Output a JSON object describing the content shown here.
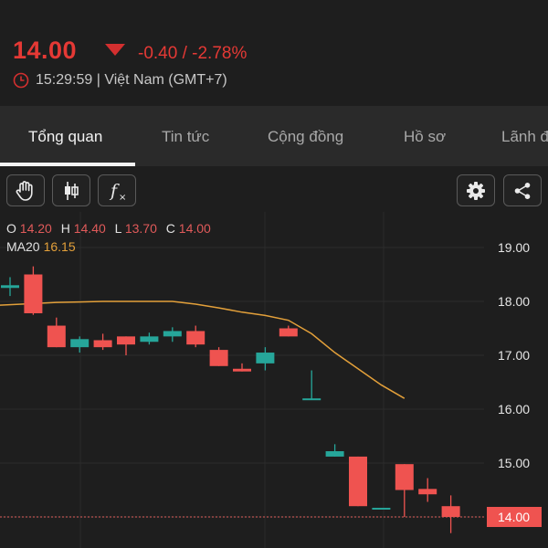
{
  "quote": {
    "price": "14.00",
    "change": "-0.40 / -2.78%",
    "time": "15:29:59 | Việt Nam (GMT+7)",
    "direction_icon": "triangle-down-icon",
    "color_down": "#e53935"
  },
  "tabs": [
    "Tổng quan",
    "Tin tức",
    "Cộng đồng",
    "Hồ sơ",
    "Lãnh đ"
  ],
  "active_tab": "Tổng quan",
  "toolbar": {
    "left_icons": [
      "hand-icon",
      "candlestick-icon",
      "fx-indicator-icon"
    ],
    "right_icons": [
      "gear-icon",
      "share-icon"
    ]
  },
  "ohlc": {
    "o_label": "O",
    "o": "14.20",
    "h_label": "H",
    "h": "14.40",
    "l_label": "L",
    "l": "13.70",
    "c_label": "C",
    "c": "14.00"
  },
  "ma": {
    "label": "MA20",
    "value": "16.15",
    "color": "#e3a03a"
  },
  "chart_data": {
    "type": "candlestick",
    "y_ticks": [
      "19.00",
      "18.00",
      "17.00",
      "16.00",
      "15.00",
      "14.00"
    ],
    "last_price_label": "14.00",
    "colors": {
      "up": "#26a69a",
      "down": "#ef5350",
      "ma": "#e3a03a"
    },
    "candles": [
      {
        "o": 18.25,
        "h": 18.45,
        "l": 18.1,
        "c": 18.3
      },
      {
        "o": 18.5,
        "h": 18.65,
        "l": 17.75,
        "c": 17.78
      },
      {
        "o": 17.55,
        "h": 17.7,
        "l": 17.15,
        "c": 17.15
      },
      {
        "o": 17.15,
        "h": 17.35,
        "l": 17.05,
        "c": 17.3
      },
      {
        "o": 17.28,
        "h": 17.4,
        "l": 17.1,
        "c": 17.15
      },
      {
        "o": 17.35,
        "h": 17.35,
        "l": 17.0,
        "c": 17.2
      },
      {
        "o": 17.25,
        "h": 17.42,
        "l": 17.2,
        "c": 17.35
      },
      {
        "o": 17.35,
        "h": 17.52,
        "l": 17.25,
        "c": 17.45
      },
      {
        "o": 17.45,
        "h": 17.55,
        "l": 17.15,
        "c": 17.2
      },
      {
        "o": 17.1,
        "h": 17.15,
        "l": 16.8,
        "c": 16.8
      },
      {
        "o": 16.75,
        "h": 16.85,
        "l": 16.7,
        "c": 16.7
      },
      {
        "o": 16.85,
        "h": 17.15,
        "l": 16.72,
        "c": 17.05
      },
      {
        "o": 17.5,
        "h": 17.55,
        "l": 17.35,
        "c": 17.35
      },
      {
        "o": 16.2,
        "h": 16.72,
        "l": 16.17,
        "c": 16.2
      },
      {
        "o": 15.12,
        "h": 15.35,
        "l": 15.12,
        "c": 15.22
      },
      {
        "o": 15.12,
        "h": 15.12,
        "l": 14.2,
        "c": 14.2
      },
      {
        "o": 14.17,
        "h": 14.17,
        "l": 14.17,
        "c": 14.17
      },
      {
        "o": 14.98,
        "h": 14.98,
        "l": 14.0,
        "c": 14.5
      },
      {
        "o": 14.52,
        "h": 14.72,
        "l": 14.28,
        "c": 14.42
      },
      {
        "o": 14.2,
        "h": 14.4,
        "l": 13.7,
        "c": 14.0
      }
    ],
    "ma20": [
      17.93,
      17.96,
      17.98,
      17.99,
      18.0,
      18.0,
      18.0,
      18.0,
      17.95,
      17.88,
      17.8,
      17.74,
      17.65,
      17.4,
      17.05,
      16.75,
      16.45,
      16.2
    ]
  }
}
